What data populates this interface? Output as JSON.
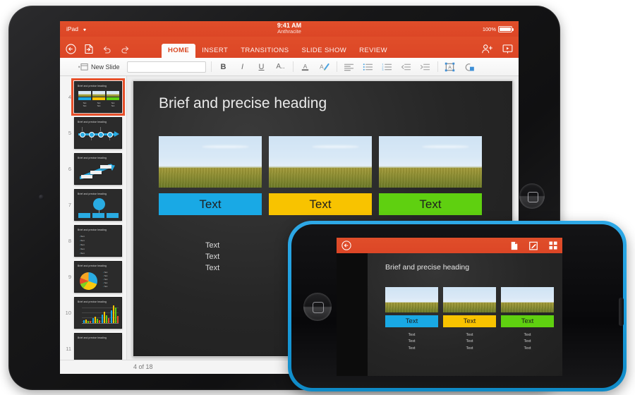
{
  "ipad": {
    "status": {
      "device_label": "iPad",
      "wifi_icon": "wifi-icon",
      "clock": "9:41 AM",
      "document_name": "Anthracite",
      "battery_percent": "100%"
    },
    "ribbon": {
      "back_icon": "back-arrow-circle-icon",
      "file_icon": "file-export-icon",
      "undo_icon": "undo-icon",
      "redo_icon": "redo-icon",
      "share_icon": "add-person-icon",
      "present_icon": "present-slideshow-icon",
      "tabs": [
        {
          "label": "HOME",
          "active": true
        },
        {
          "label": "INSERT",
          "active": false
        },
        {
          "label": "TRANSITIONS",
          "active": false
        },
        {
          "label": "SLIDE SHOW",
          "active": false
        },
        {
          "label": "REVIEW",
          "active": false
        }
      ]
    },
    "toolbar": {
      "new_slide_label": "New Slide",
      "new_slide_icon": "new-slide-icon",
      "style_field_value": "",
      "style_field_placeholder": "",
      "bold_label": "B",
      "italic_label": "I",
      "underline_label": "U",
      "more_font_label": "A..",
      "font_color_icon": "font-color-icon",
      "highlight_icon": "text-highlight-icon",
      "align_icon": "align-left-icon",
      "bullets_icon": "bulleted-list-icon",
      "numbering_icon": "numbered-list-icon",
      "outdent_icon": "decrease-indent-icon",
      "indent_icon": "increase-indent-icon",
      "textbox_icon": "text-box-icon",
      "shapes_icon": "shapes-icon"
    },
    "slide": {
      "title": "Brief and precise heading",
      "cards": [
        {
          "label": "Text",
          "color": "#19a9e5"
        },
        {
          "label": "Text",
          "color": "#f8c300"
        },
        {
          "label": "Text",
          "color": "#5fd010"
        }
      ],
      "text_lines": [
        "Text",
        "Text",
        "Text"
      ],
      "status": "4 of 18"
    },
    "thumbnails": [
      {
        "number": "4",
        "title": "Brief and precise heading",
        "kind": "cards",
        "selected": true
      },
      {
        "number": "5",
        "title": "Brief and precise heading",
        "kind": "timeline",
        "selected": false
      },
      {
        "number": "6",
        "title": "Brief and precise heading",
        "kind": "arrow",
        "selected": false
      },
      {
        "number": "7",
        "title": "Brief and precise heading",
        "kind": "orgchart",
        "selected": false
      },
      {
        "number": "8",
        "title": "Brief and precise heading",
        "kind": "bullets",
        "selected": false
      },
      {
        "number": "9",
        "title": "Brief and precise heading",
        "kind": "pie",
        "selected": false
      },
      {
        "number": "10",
        "title": "Brief and precise heading",
        "kind": "bar",
        "selected": false
      },
      {
        "number": "11",
        "title": "Brief and precise heading",
        "kind": "cards",
        "selected": false
      }
    ],
    "thumb_bullet_text": "Text",
    "thumb_card_text": "Text"
  },
  "iphone": {
    "topbar": {
      "back_icon": "back-arrow-circle-icon",
      "file_icon": "document-icon",
      "edit_icon": "edit-pencil-icon",
      "grid_icon": "grid-view-icon"
    },
    "slide": {
      "title": "Brief and precise heading",
      "cards": [
        {
          "label": "Text",
          "color": "#19a9e5"
        },
        {
          "label": "Text",
          "color": "#f8c300"
        },
        {
          "label": "Text",
          "color": "#5fd010"
        }
      ],
      "text_lines": [
        "Text",
        "Text",
        "Text"
      ]
    }
  },
  "colors": {
    "brand_red": "#dc4626",
    "accent_blue": "#19a9e5",
    "accent_yellow": "#f8c300",
    "accent_green": "#5fd010",
    "selection": "#e8502a",
    "iphone_bezel": "#1b9ddd"
  }
}
